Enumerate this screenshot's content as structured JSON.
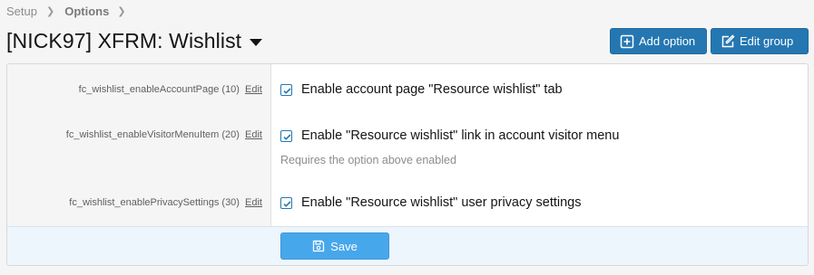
{
  "breadcrumb": {
    "items": [
      "Setup",
      "Options"
    ]
  },
  "header": {
    "title": "[NICK97] XFRM: Wishlist"
  },
  "actions": {
    "add_option": "Add option",
    "edit_group": "Edit group"
  },
  "options": [
    {
      "id_label": "fc_wishlist_enableAccountPage (10)",
      "edit": "Edit",
      "label": "Enable account page \"Resource wishlist\" tab",
      "checked": true
    },
    {
      "id_label": "fc_wishlist_enableVisitorMenuItem (20)",
      "edit": "Edit",
      "label": "Enable \"Resource wishlist\" link in account visitor menu",
      "hint": "Requires the option above enabled",
      "checked": true
    },
    {
      "id_label": "fc_wishlist_enablePrivacySettings (30)",
      "edit": "Edit",
      "label": "Enable \"Resource wishlist\" user privacy settings",
      "checked": true
    }
  ],
  "footer": {
    "save_label": "Save"
  },
  "colors": {
    "primary": "#2577b1",
    "save": "#47a7eb",
    "footer_bg": "#edf5fd"
  }
}
